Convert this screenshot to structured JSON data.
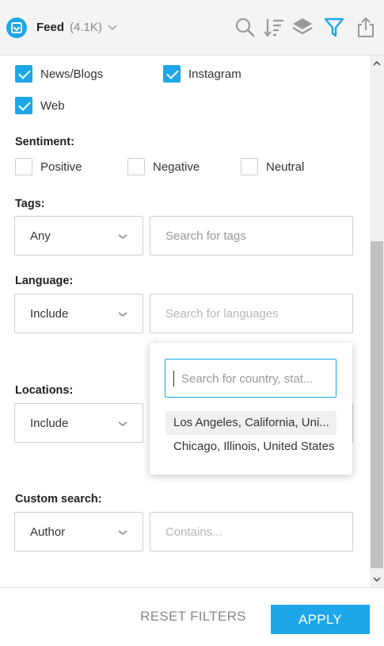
{
  "header": {
    "title": "Feed",
    "count": "(4.1K)",
    "icons": [
      "search-icon",
      "sort-icon",
      "layers-icon",
      "filter-icon",
      "share-icon"
    ],
    "accent": "#1ea7e8"
  },
  "sources": {
    "items": [
      {
        "label": "News/Blogs",
        "checked": true
      },
      {
        "label": "Instagram",
        "checked": true
      },
      {
        "label": "Web",
        "checked": true
      }
    ]
  },
  "sentiment": {
    "label": "Sentiment:",
    "items": [
      {
        "label": "Positive",
        "checked": false
      },
      {
        "label": "Negative",
        "checked": false
      },
      {
        "label": "Neutral",
        "checked": false
      }
    ]
  },
  "tags": {
    "label": "Tags:",
    "select_value": "Any",
    "search_placeholder": "Search for tags"
  },
  "language": {
    "label": "Language:",
    "select_value": "Include",
    "search_placeholder": "Search for languages"
  },
  "locations": {
    "label": "Locations:",
    "select_value": "Include",
    "popup": {
      "search_placeholder": "Search for country, stat...",
      "options": [
        "Los Angeles, California, Uni...",
        "Chicago, Illinois, United States"
      ]
    }
  },
  "custom_search": {
    "label": "Custom search:",
    "select_value": "Author",
    "search_placeholder": "Contains..."
  },
  "footer": {
    "reset_label": "RESET FILTERS",
    "apply_label": "APPLY"
  }
}
